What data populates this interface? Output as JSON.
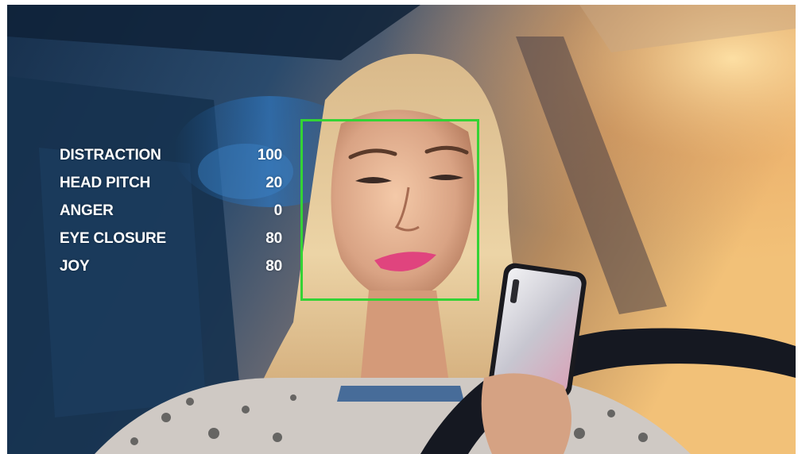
{
  "metrics": [
    {
      "label": "DISTRACTION",
      "value": "100"
    },
    {
      "label": "HEAD PITCH",
      "value": "20"
    },
    {
      "label": "ANGER",
      "value": "0"
    },
    {
      "label": "EYE CLOSURE",
      "value": "80"
    },
    {
      "label": "JOY",
      "value": "80"
    }
  ],
  "colors": {
    "face_box": "#34d335",
    "text": "#ffffff"
  }
}
